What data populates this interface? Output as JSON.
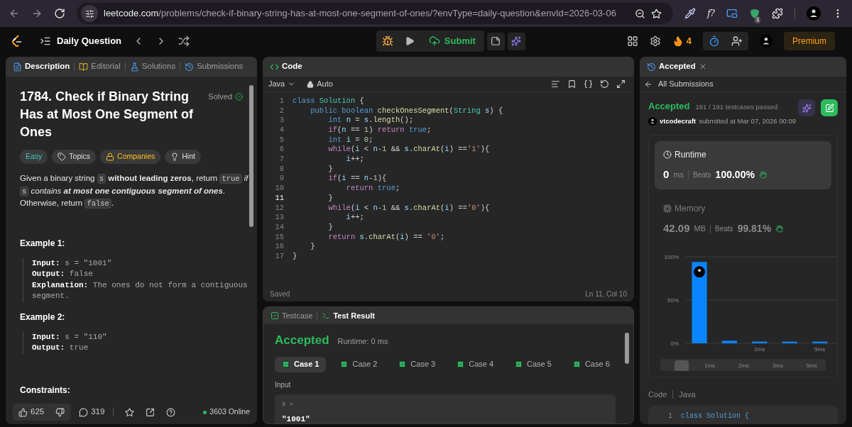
{
  "browser": {
    "url_host": "leetcode.com",
    "url_path": "/problems/check-if-binary-string-has-at-most-one-segment-of-ones/?envType=daily-question&envId=2026-03-06",
    "extension_label": "f?",
    "extension_badge": "1"
  },
  "header": {
    "title": "Daily Question",
    "submit": "Submit",
    "streak": "4",
    "premium": "Premium"
  },
  "left_panel": {
    "tabs": [
      {
        "label": "Description",
        "selected": true
      },
      {
        "label": "Editorial",
        "selected": false
      },
      {
        "label": "Solutions",
        "selected": false
      },
      {
        "label": "Submissions",
        "selected": false
      }
    ],
    "title": "1784. Check if Binary String Has at Most One Segment of Ones",
    "solved": "Solved",
    "tags": [
      {
        "kind": "difficulty",
        "label": "Easy"
      },
      {
        "kind": "topics",
        "label": "Topics"
      },
      {
        "kind": "companies",
        "label": "Companies"
      },
      {
        "kind": "hint",
        "label": "Hint"
      }
    ],
    "description": [
      {
        "kind": "text",
        "text": "Given a binary string "
      },
      {
        "kind": "code",
        "text": "s"
      },
      {
        "kind": "text",
        "text": " **without leading zeros**, return "
      },
      {
        "kind": "code",
        "text": "true"
      },
      {
        "kind": "italic",
        "text": " if "
      },
      {
        "kind": "code",
        "text": "s"
      },
      {
        "kind": "italic",
        "text": " contains **at most one contiguous segment of ones**"
      },
      {
        "kind": "text",
        "text": ". Otherwise, return "
      },
      {
        "kind": "code",
        "text": "false"
      },
      {
        "kind": "text",
        "text": "."
      }
    ],
    "examples": [
      {
        "title": "Example 1:",
        "lines": [
          {
            "label": "Input:",
            "value": "s = \"1001\""
          },
          {
            "label": "Output:",
            "value": "false"
          },
          {
            "label": "Explanation:",
            "value": "The ones do not form a contiguous segment."
          }
        ]
      },
      {
        "title": "Example 2:",
        "lines": [
          {
            "label": "Input:",
            "value": "s = \"110\""
          },
          {
            "label": "Output:",
            "value": "true"
          }
        ]
      }
    ],
    "constraints_title": "Constraints:",
    "footer": {
      "likes": "625",
      "comments": "319",
      "online": "3603 Online"
    }
  },
  "code_panel": {
    "title": "Code",
    "language": "Java",
    "mode": "Auto",
    "lines": [
      {
        "number": "1",
        "current": false,
        "tokens": [
          {
            "kind": "kw",
            "text": "class "
          },
          {
            "kind": "type",
            "text": "Solution"
          },
          {
            "kind": "plain",
            "text": " {"
          }
        ]
      },
      {
        "number": "2",
        "current": false,
        "tokens": [
          {
            "kind": "kw",
            "text": "    public boolean "
          },
          {
            "kind": "fn",
            "text": "checkOnesSegment"
          },
          {
            "kind": "plain",
            "text": "("
          },
          {
            "kind": "type",
            "text": "String"
          },
          {
            "kind": "var",
            "text": " s"
          },
          {
            "kind": "plain",
            "text": ") {"
          }
        ]
      },
      {
        "number": "3",
        "current": false,
        "tokens": [
          {
            "kind": "kw",
            "text": "        int "
          },
          {
            "kind": "var",
            "text": "n"
          },
          {
            "kind": "plain",
            "text": " = "
          },
          {
            "kind": "var",
            "text": "s"
          },
          {
            "kind": "plain",
            "text": "."
          },
          {
            "kind": "fn",
            "text": "length"
          },
          {
            "kind": "plain",
            "text": "();"
          }
        ]
      },
      {
        "number": "4",
        "current": false,
        "tokens": [
          {
            "kind": "ctl",
            "text": "        if"
          },
          {
            "kind": "plain",
            "text": "("
          },
          {
            "kind": "var",
            "text": "n"
          },
          {
            "kind": "plain",
            "text": " == "
          },
          {
            "kind": "num",
            "text": "1"
          },
          {
            "kind": "plain",
            "text": ") "
          },
          {
            "kind": "ctl",
            "text": "return "
          },
          {
            "kind": "kw",
            "text": "true"
          },
          {
            "kind": "plain",
            "text": ";"
          }
        ]
      },
      {
        "number": "5",
        "current": false,
        "tokens": [
          {
            "kind": "kw",
            "text": "        int "
          },
          {
            "kind": "var",
            "text": "i"
          },
          {
            "kind": "plain",
            "text": " = "
          },
          {
            "kind": "num",
            "text": "0"
          },
          {
            "kind": "plain",
            "text": ";"
          }
        ]
      },
      {
        "number": "6",
        "current": false,
        "tokens": [
          {
            "kind": "ctl",
            "text": "        while"
          },
          {
            "kind": "plain",
            "text": "("
          },
          {
            "kind": "var",
            "text": "i"
          },
          {
            "kind": "plain",
            "text": " < "
          },
          {
            "kind": "var",
            "text": "n"
          },
          {
            "kind": "plain",
            "text": "-"
          },
          {
            "kind": "num",
            "text": "1"
          },
          {
            "kind": "plain",
            "text": " && "
          },
          {
            "kind": "var",
            "text": "s"
          },
          {
            "kind": "plain",
            "text": "."
          },
          {
            "kind": "fn",
            "text": "charAt"
          },
          {
            "kind": "plain",
            "text": "("
          },
          {
            "kind": "var",
            "text": "i"
          },
          {
            "kind": "plain",
            "text": ") =="
          },
          {
            "kind": "str",
            "text": "'1'"
          },
          {
            "kind": "plain",
            "text": "){"
          }
        ]
      },
      {
        "number": "7",
        "current": false,
        "tokens": [
          {
            "kind": "var",
            "text": "            i"
          },
          {
            "kind": "plain",
            "text": "++;"
          }
        ]
      },
      {
        "number": "8",
        "current": false,
        "tokens": [
          {
            "kind": "plain",
            "text": "        }"
          }
        ]
      },
      {
        "number": "9",
        "current": false,
        "tokens": [
          {
            "kind": "ctl",
            "text": "        if"
          },
          {
            "kind": "plain",
            "text": "("
          },
          {
            "kind": "var",
            "text": "i"
          },
          {
            "kind": "plain",
            "text": " == "
          },
          {
            "kind": "var",
            "text": "n"
          },
          {
            "kind": "plain",
            "text": "-"
          },
          {
            "kind": "num",
            "text": "1"
          },
          {
            "kind": "plain",
            "text": "){"
          }
        ]
      },
      {
        "number": "10",
        "current": false,
        "tokens": [
          {
            "kind": "ctl",
            "text": "            return "
          },
          {
            "kind": "kw",
            "text": "true"
          },
          {
            "kind": "plain",
            "text": ";"
          }
        ]
      },
      {
        "number": "11",
        "current": true,
        "tokens": [
          {
            "kind": "plain",
            "text": "        }"
          }
        ]
      },
      {
        "number": "12",
        "current": false,
        "tokens": [
          {
            "kind": "ctl",
            "text": "        while"
          },
          {
            "kind": "plain",
            "text": "("
          },
          {
            "kind": "var",
            "text": "i"
          },
          {
            "kind": "plain",
            "text": " < "
          },
          {
            "kind": "var",
            "text": "n"
          },
          {
            "kind": "plain",
            "text": "-"
          },
          {
            "kind": "num",
            "text": "1"
          },
          {
            "kind": "plain",
            "text": " && "
          },
          {
            "kind": "var",
            "text": "s"
          },
          {
            "kind": "plain",
            "text": "."
          },
          {
            "kind": "fn",
            "text": "charAt"
          },
          {
            "kind": "plain",
            "text": "("
          },
          {
            "kind": "var",
            "text": "i"
          },
          {
            "kind": "plain",
            "text": ") =="
          },
          {
            "kind": "str",
            "text": "'0'"
          },
          {
            "kind": "plain",
            "text": "){"
          }
        ]
      },
      {
        "number": "13",
        "current": false,
        "tokens": [
          {
            "kind": "var",
            "text": "            i"
          },
          {
            "kind": "plain",
            "text": "++;"
          }
        ]
      },
      {
        "number": "14",
        "current": false,
        "tokens": [
          {
            "kind": "plain",
            "text": "        }"
          }
        ]
      },
      {
        "number": "15",
        "current": false,
        "tokens": [
          {
            "kind": "ctl",
            "text": "        return "
          },
          {
            "kind": "var",
            "text": "s"
          },
          {
            "kind": "plain",
            "text": "."
          },
          {
            "kind": "fn",
            "text": "charAt"
          },
          {
            "kind": "plain",
            "text": "("
          },
          {
            "kind": "var",
            "text": "i"
          },
          {
            "kind": "plain",
            "text": ") == "
          },
          {
            "kind": "str",
            "text": "'0'"
          },
          {
            "kind": "plain",
            "text": ";"
          }
        ]
      },
      {
        "number": "16",
        "current": false,
        "tokens": [
          {
            "kind": "plain",
            "text": "    }"
          }
        ]
      },
      {
        "number": "17",
        "current": false,
        "tokens": [
          {
            "kind": "plain",
            "text": "}"
          }
        ]
      }
    ],
    "status": "Saved",
    "cursor": "Ln 11, Col 10"
  },
  "test_panel": {
    "tabs": [
      {
        "label": "Testcase",
        "selected": false
      },
      {
        "label": "Test Result",
        "selected": true
      }
    ],
    "verdict": "Accepted",
    "runtime": "Runtime: 0 ms",
    "cases": [
      {
        "label": "Case 1",
        "selected": true
      },
      {
        "label": "Case 2",
        "selected": false
      },
      {
        "label": "Case 3",
        "selected": false
      },
      {
        "label": "Case 4",
        "selected": false
      },
      {
        "label": "Case 5",
        "selected": false
      },
      {
        "label": "Case 6",
        "selected": false
      }
    ],
    "input_label": "Input",
    "input_name": "s =",
    "input_value": "\"1001\""
  },
  "right_panel": {
    "tab": "Accepted",
    "back": "All Submissions",
    "status": "Accepted",
    "passed": "191 / 191 testcases passed",
    "user": "vtcodecraft",
    "submitted": "submitted at Mar 07, 2026 00:09",
    "runtime": {
      "label": "Runtime",
      "value": "0",
      "unit": "ms",
      "beats": "Beats",
      "percent": "100.00%",
      "selected": true
    },
    "memory": {
      "label": "Memory",
      "value": "42.09",
      "unit": "MB",
      "beats": "Beats",
      "percent": "99.81%",
      "selected": false
    },
    "chart_data": {
      "type": "bar",
      "categories": [
        null,
        null,
        "2ms",
        null,
        "5ms"
      ],
      "values": [
        94,
        3,
        2,
        2,
        2
      ],
      "ylim": [
        0,
        100
      ],
      "yticks": [
        {
          "value": 0,
          "label": "0%"
        },
        {
          "value": 50,
          "label": "50%"
        },
        {
          "value": 100,
          "label": "100%"
        }
      ]
    },
    "range_labels": [
      "1ms",
      "2ms",
      "3ms",
      "5ms"
    ],
    "code_title": "Code",
    "code_language": "Java",
    "code_line_number": "1",
    "code_line": "class Solution {"
  }
}
